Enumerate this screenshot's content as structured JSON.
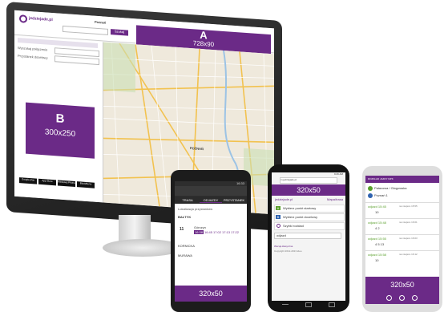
{
  "desktop": {
    "brand": "jedziejade.pl",
    "city": "Poznań",
    "search_button": "Szukaj",
    "sidebar_label_1": "Wyszukaj połączenie",
    "sidebar_label_2": "Przystanek docelowy",
    "map_city_label": "POZNAŃ",
    "ad_a": {
      "letter": "A",
      "size": "728x90"
    },
    "ad_b": {
      "letter": "B",
      "size": "300x250"
    },
    "store_badges": [
      "Google play",
      "App Store",
      "Windows Phone",
      "BlackBerry"
    ]
  },
  "phone1": {
    "time": "16:33",
    "tabs": [
      "TRASA",
      "ODJAZDY",
      "PRZYSTANEK"
    ],
    "list_header": "Lokalizacja przystanków",
    "stop_1": "BAŁTYK",
    "line_no": "11",
    "line_dir": "Górczyn",
    "times": [
      "16:38",
      "16:45",
      "17:02",
      "17:13",
      "17:22"
    ],
    "stop_2": "KORNICKA",
    "stop_3": "MURAWA",
    "ad": "320x50"
  },
  "phone2": {
    "time": "9:26 AM",
    "url": "m.jedziejade.pl",
    "ad": "320x50",
    "brand": "jedziejade.pl",
    "link_right": "Mapa/trasa",
    "items": [
      {
        "badge": "A",
        "label": "Wybierz punkt startowy"
      },
      {
        "badge": "B",
        "label": "Wybierz punkt docelowy"
      },
      {
        "badge": "",
        "label": "Szybki rozkład"
      }
    ],
    "input_value": "odjazd",
    "footer_link": "Wersja klasyczna",
    "copyright": "Copyright 2012-2013 ideo"
  },
  "phone3": {
    "title": "ROZKŁAD JAZDY MPK",
    "from": "Pałacowa / Głogowska",
    "to": "Poznań 1",
    "trips": [
      {
        "time": "odjazd 15:45",
        "note": "na miejscu 15:55",
        "lines": "10"
      },
      {
        "time": "odjazd 15:48",
        "note": "na miejscu 16:01",
        "lines": "4  2"
      },
      {
        "time": "odjazd 15:55",
        "note": "na miejscu 16:03",
        "lines": "4  5  13"
      },
      {
        "time": "odjazd 15:58",
        "note": "na miejscu 16:12",
        "lines": "10"
      }
    ],
    "ad": "320x50"
  },
  "colors": {
    "purple": "#6b2a87",
    "monitor": "#2b2b2b",
    "map_bg": "#efe9dc"
  }
}
